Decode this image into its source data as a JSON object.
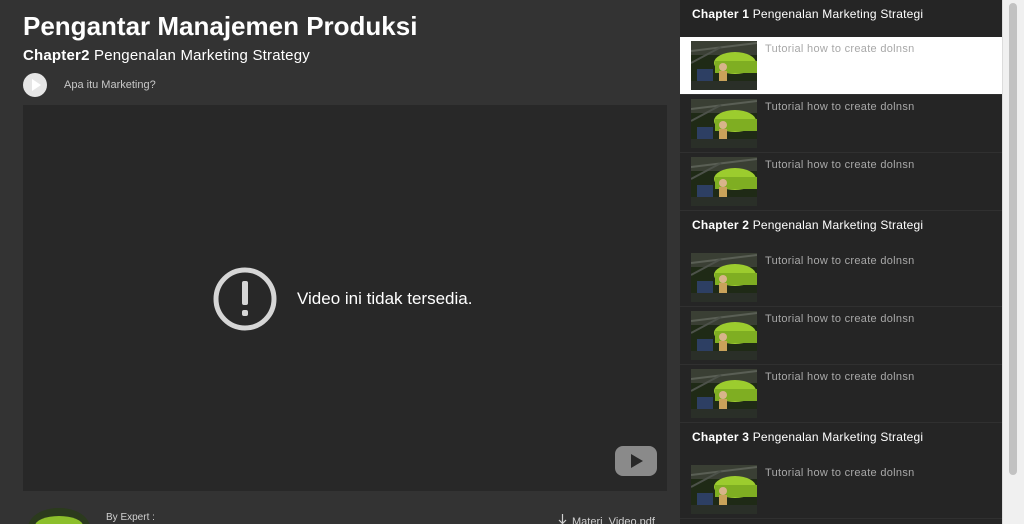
{
  "course": {
    "title": "Pengantar Manajemen Produksi",
    "chapter_prefix": "Chapter2",
    "chapter_name": "Pengenalan Marketing Strategy",
    "lesson_title": "Apa itu Marketing?"
  },
  "video": {
    "unavailable_text": "Video ini tidak tersedia."
  },
  "expert": {
    "by_label": "By Expert :"
  },
  "download": {
    "label": "Materi_Video.pdf"
  },
  "sidebar": {
    "chapters": [
      {
        "prefix": "Chapter 1",
        "name": "Pengenalan Marketing Strategi",
        "items": [
          {
            "label": "Tutorial how to create dolnsn",
            "active": true
          },
          {
            "label": "Tutorial how to create dolnsn",
            "active": false
          },
          {
            "label": "Tutorial how to create dolnsn",
            "active": false
          }
        ]
      },
      {
        "prefix": "Chapter 2",
        "name": "Pengenalan Marketing Strategi",
        "items": [
          {
            "label": "Tutorial how to create dolnsn",
            "active": false
          },
          {
            "label": "Tutorial how to create dolnsn",
            "active": false
          },
          {
            "label": "Tutorial how to create dolnsn",
            "active": false
          }
        ]
      },
      {
        "prefix": "Chapter 3",
        "name": "Pengenalan Marketing Strategi",
        "items": [
          {
            "label": "Tutorial how to create dolnsn",
            "active": false
          }
        ]
      }
    ]
  },
  "icons": {
    "play": "play-icon",
    "alert": "alert-circle-icon",
    "youtube": "youtube-logo-icon",
    "download": "download-icon"
  },
  "colors": {
    "background": "#333333",
    "video_bg": "#282828",
    "sidebar_bg": "#252525",
    "active_item_bg": "#ffffff",
    "muted_text": "#a8a8a8"
  }
}
